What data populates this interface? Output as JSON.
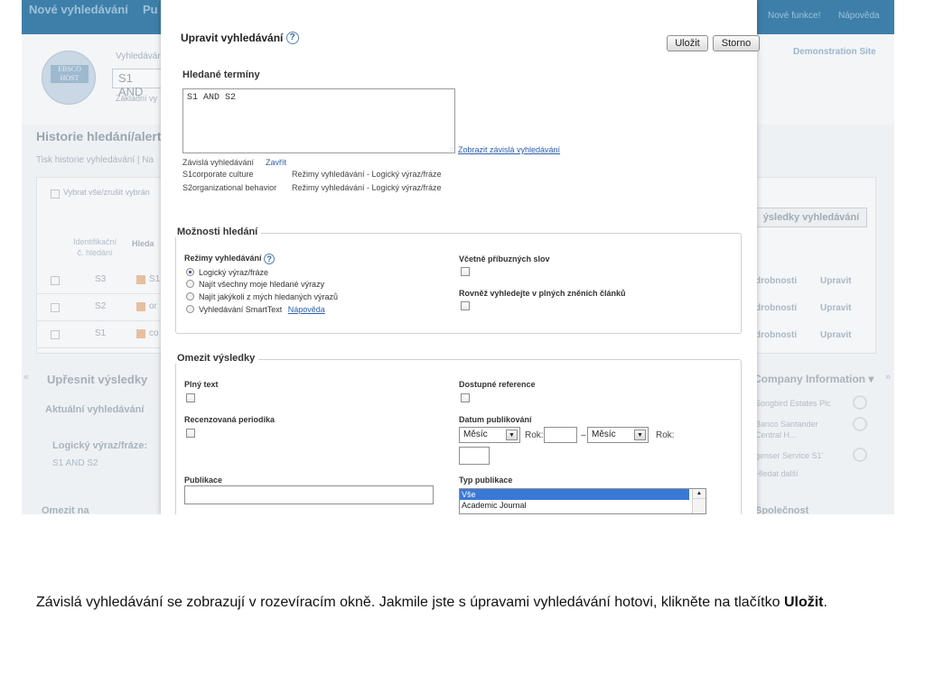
{
  "background": {
    "topbar_left": "Nové vyhledávání",
    "topbar_left2": "Pu",
    "topbar_right1": "Nové funkce!",
    "topbar_right2": "Nápověda",
    "site_name": "Demonstration Site",
    "search_label": "Vyhledávár",
    "search_value": "S1 AND",
    "basic_link": "Základní vy",
    "history_title": "Historie hledání/alert",
    "history_tabs": "Tisk historie vyhledávání  |  Na",
    "select_all": "Vybrat vše/zrušit vybrán",
    "col_id": "Identifikační č. hledání",
    "col_search": "Hleda",
    "rows": [
      {
        "id": "S3",
        "txt": "S1"
      },
      {
        "id": "S2",
        "txt": "or"
      },
      {
        "id": "S1",
        "txt": "co"
      }
    ],
    "results_button": "ýsledky vyhledávání",
    "details_link": "drobnosti",
    "edit_link": "Upravit",
    "refine_title": "Upřesnit výsledky",
    "current_search": "Aktuální vyhledávání",
    "bool_label": "Logický výraz/fráze:",
    "bool_value": "S1 AND S2",
    "limit_to": "Omezit na",
    "company_title": "Company Information",
    "companies": [
      "Songbird Estates Plc",
      "Banco Santander Central H...",
      "genser Service S1'"
    ],
    "search_more": "Hledat další",
    "company_bottom": "Společnost"
  },
  "dialog": {
    "title": "Upravit vyhledávání",
    "save_button": "Uložit",
    "cancel_button": "Storno",
    "terms_heading": "Hledané termíny",
    "terms_value": "S1 AND S2",
    "show_dependent_link": "Zobrazit závislá vyhledávání",
    "dependent_label": "Závislá vyhledávání",
    "close_link": "Zavřít",
    "dependent_rows": [
      {
        "name": "S1corporate culture",
        "mode": "Režimy vyhledávání - Logický výraz/fráze"
      },
      {
        "name": "S2organizational behavior",
        "mode": "Režimy vyhledávání - Logický výraz/fráze"
      }
    ],
    "options_legend": "Možnosti hledání",
    "modes_label": "Režimy vyhledávání",
    "modes": [
      {
        "label": "Logický výraz/fráze",
        "selected": true
      },
      {
        "label": "Najít všechny moje hledané výrazy",
        "selected": false
      },
      {
        "label": "Najít jakýkoli z mých hledaných výrazů",
        "selected": false
      },
      {
        "label": "Vyhledávání SmartText",
        "selected": false
      }
    ],
    "help_link": "Nápověda",
    "related_words": "Včetně příbuzných slov",
    "fulltext_search": "Rovněž vyhledejte v plných zněních článků",
    "limit_legend": "Omezit výsledky",
    "full_text": "Plný text",
    "available_refs": "Dostupné reference",
    "peer_reviewed": "Recenzovaná periodika",
    "pub_date": "Datum publikování",
    "month_placeholder": "Měsíc",
    "year_label": "Rok:",
    "dash": "–",
    "publication": "Publikace",
    "pub_type": "Typ publikace",
    "pub_type_options": [
      "Vše",
      "Academic Journal"
    ]
  },
  "caption": {
    "text_before": "Závislá vyhledávání se zobrazují v rozevíracím okně. Jakmile jste s úpravami vyhledávání hotovi, klikněte na tlačítko ",
    "bold": "Uložit",
    "text_after": "."
  }
}
